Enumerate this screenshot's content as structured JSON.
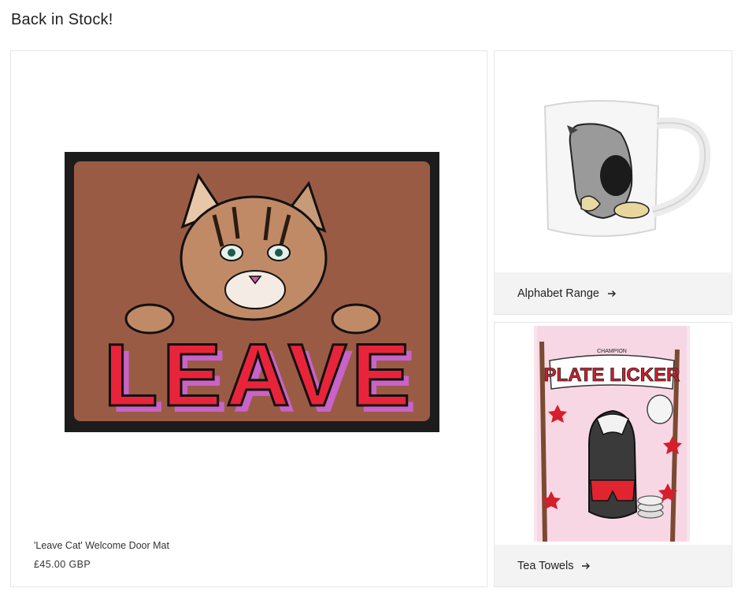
{
  "section": {
    "title": "Back in Stock!"
  },
  "featured_product": {
    "title": "'Leave Cat' Welcome Door Mat",
    "price": "£45.00 GBP",
    "image_text": "LEAVE"
  },
  "collections": [
    {
      "label": "Alphabet Range",
      "icon": "arrow-right-icon"
    },
    {
      "label": "Tea Towels",
      "icon": "arrow-right-icon"
    }
  ],
  "tea_towel_image": {
    "top_text": "CHAMPION",
    "main_text": "PLATE LICKER"
  },
  "colors": {
    "mat_brown": "#9a5b45",
    "letter_red": "#e8243a",
    "letter_pink": "#c863c8",
    "link_bg": "#f3f3f3"
  }
}
